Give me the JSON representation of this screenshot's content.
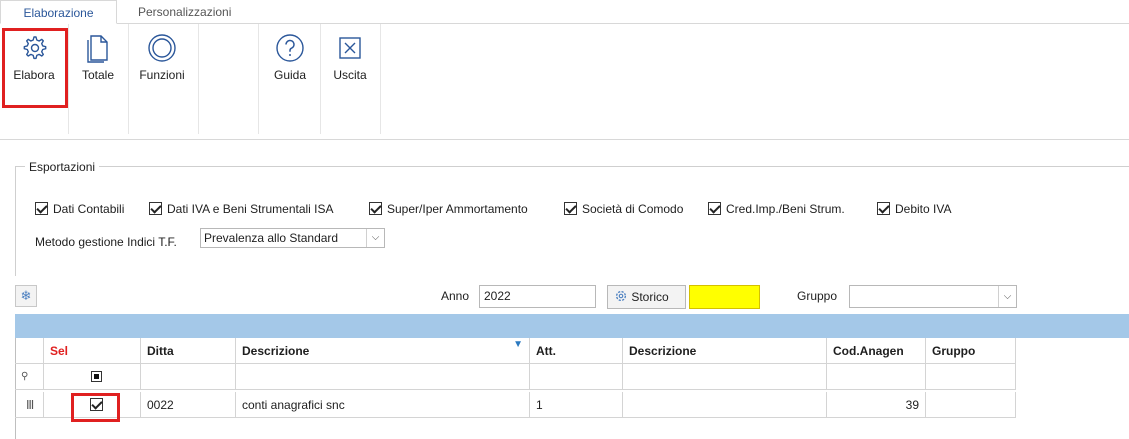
{
  "tabs": [
    "Elaborazione",
    "Personalizzazioni"
  ],
  "ribbon": {
    "elabora": "Elabora",
    "totale": "Totale",
    "funzioni": "Funzioni",
    "guida": "Guida",
    "uscita": "Uscita"
  },
  "esportazioni": {
    "legend": "Esportazioni",
    "checks": [
      "Dati Contabili",
      "Dati IVA e Beni Strumentali ISA",
      "Super/Iper Ammortamento",
      "Società di Comodo",
      "Cred.Imp./Beni Strum.",
      "Debito IVA"
    ],
    "metodo_label": "Metodo gestione Indici T.F.",
    "metodo_value": "Prevalenza allo Standard"
  },
  "filter": {
    "anno_label": "Anno",
    "anno_value": "2022",
    "storico": "Storico",
    "gruppo_label": "Gruppo",
    "gruppo_value": ""
  },
  "grid": {
    "headers": [
      "Sel",
      "Ditta",
      "Descrizione",
      "Att.",
      "Descrizione",
      "Cod.Anagen",
      "Gruppo"
    ],
    "row": {
      "ditta": "0022",
      "descrizione": "conti anagrafici snc",
      "att": "1",
      "descrizione2": "",
      "cod_anagen": "39",
      "gruppo": ""
    }
  },
  "colors": {
    "accent": "#2b579a",
    "highlight": "#e02020",
    "grid_bar": "#a4c8e8",
    "sel_header": "#e02020",
    "storico_field": "#ffff00"
  }
}
